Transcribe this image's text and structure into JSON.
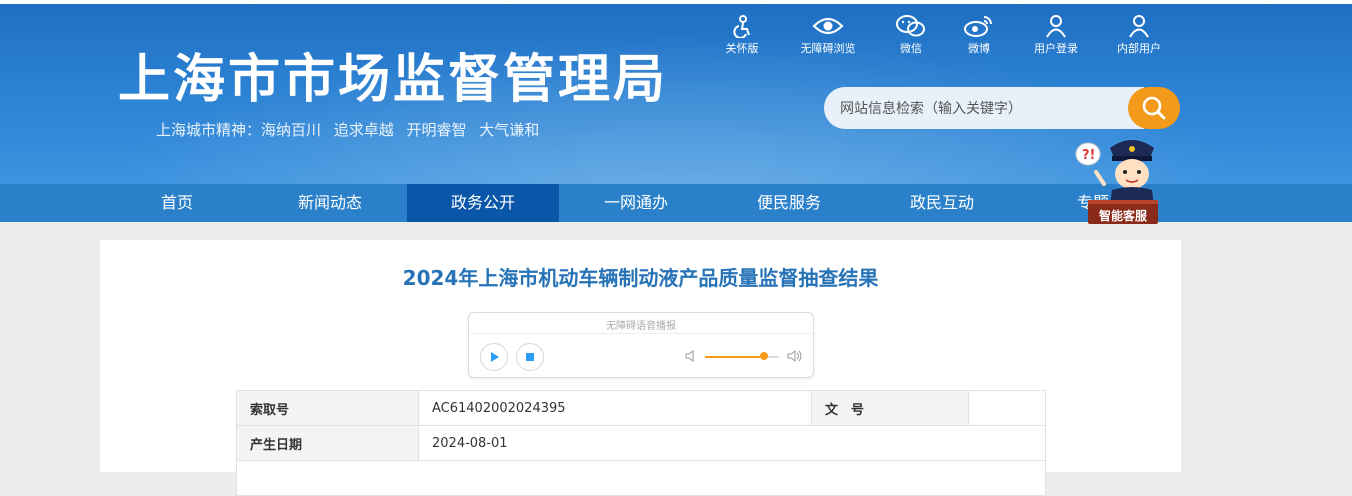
{
  "header": {
    "site_title": "上海市市场监督管理局",
    "slogan": "上海城市精神：海纳百川   追求卓越   开明睿智   大气谦和",
    "tools": [
      {
        "label": "关怀版",
        "icon": "care-icon"
      },
      {
        "label": "无障碍浏览",
        "icon": "eye-icon"
      },
      {
        "label": "微信",
        "icon": "wechat-icon"
      },
      {
        "label": "微博",
        "icon": "weibo-icon"
      },
      {
        "label": "用户登录",
        "icon": "user-icon"
      },
      {
        "label": "内部用户",
        "icon": "user-icon"
      }
    ],
    "search": {
      "placeholder": "网站信息检索（输入关键字）",
      "value": ""
    },
    "assistant_label": "智能客服"
  },
  "nav": {
    "items": [
      "首页",
      "新闻动态",
      "政务公开",
      "一网通办",
      "便民服务",
      "政民互动",
      "专题"
    ],
    "active": "政务公开"
  },
  "article": {
    "title": "2024年上海市机动车辆制动液产品质量监督抽查结果",
    "player": {
      "label": "无障碍语音播报",
      "volume": 0.8
    },
    "meta": {
      "index_no_label": "索取号",
      "index_no": "AC61402002024395",
      "doc_no_label": "文　号",
      "doc_no": "",
      "date_label": "产生日期",
      "date": "2024-08-01"
    }
  },
  "colors": {
    "header_blue": "#2c82d3",
    "nav_blue": "#2a81c9",
    "nav_active": "#0a56a8",
    "accent_orange": "#f39a1b",
    "title_blue": "#2773b8"
  }
}
